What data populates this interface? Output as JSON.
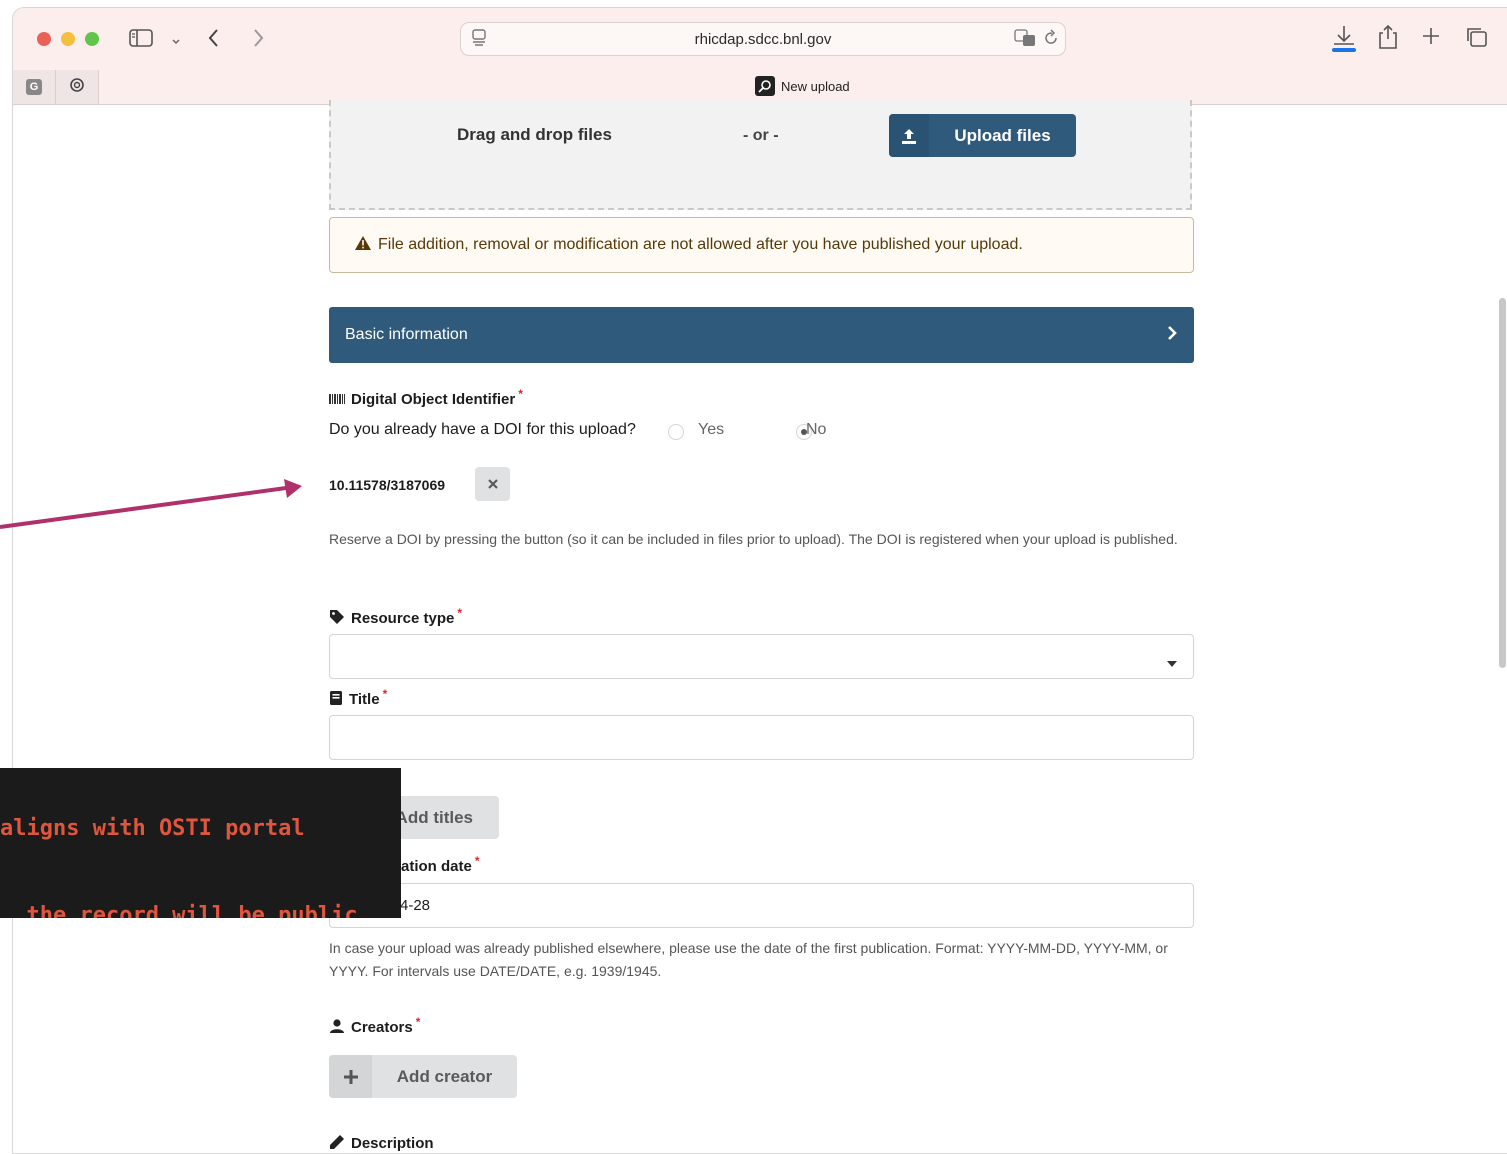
{
  "browser": {
    "url": "rhicdap.sdcc.bnl.gov",
    "active_tab_title": "New upload",
    "pinned_tabs": [
      "G",
      "chatgpt"
    ]
  },
  "dropzone": {
    "drag_label": "Drag and drop files",
    "or_label": "- or -",
    "upload_button": "Upload files"
  },
  "warning": {
    "text": "File addition, removal or modification are not allowed after you have published your upload."
  },
  "basic_info": {
    "header": "Basic information"
  },
  "doi": {
    "label": "Digital Object Identifier",
    "required": "*",
    "question": "Do you already have a DOI for this upload?",
    "options": [
      "Yes",
      "No"
    ],
    "selected": "No",
    "value": "10.11578/3187069",
    "help": "Reserve a DOI by pressing the button (so it can be included in files prior to upload). The DOI is registered when your upload is published."
  },
  "resource_type": {
    "label": "Resource type",
    "required": "*",
    "value": ""
  },
  "title": {
    "label": "Title",
    "required": "*",
    "value": "",
    "add_titles_button": "Add titles"
  },
  "publication_date": {
    "label_visible": "ation date",
    "required": "*",
    "value_visible": "4-28",
    "help": "In case your upload was already published elsewhere, please use the date of the first publication. Format: YYYY-MM-DD, YYYY-MM, or YYYY. For intervals use DATE/DATE, e.g. 1939/1945."
  },
  "creators": {
    "label": "Creators",
    "required": "*",
    "add_button": "Add creator"
  },
  "description": {
    "label": "Description"
  },
  "overlay": {
    "line1": "aligns with OSTI portal",
    "line2": "  the record will be public"
  },
  "colors": {
    "primary": "#2f5a7b",
    "warning_bg": "#fffaf3",
    "warning_text": "#573a08",
    "required": "#db2828",
    "annotation_arrow": "#b0306b",
    "terminal_text": "#e0553d"
  }
}
